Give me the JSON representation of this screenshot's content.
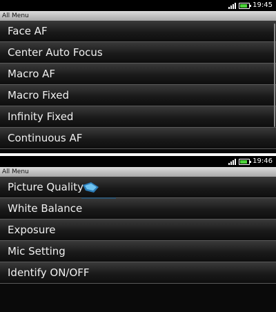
{
  "screen1": {
    "status": {
      "time": "19:45",
      "battery_level": 0.7
    },
    "title": "All Menu",
    "items": [
      {
        "label": "Face AF"
      },
      {
        "label": "Center Auto Focus"
      },
      {
        "label": "Macro AF"
      },
      {
        "label": "Macro Fixed"
      },
      {
        "label": "Infinity Fixed"
      },
      {
        "label": "Continuous AF"
      }
    ]
  },
  "screen2": {
    "status": {
      "time": "19:46",
      "battery_level": 0.7
    },
    "title": "All Menu",
    "items": [
      {
        "label": "Picture Quality"
      },
      {
        "label": "White Balance"
      },
      {
        "label": "Exposure"
      },
      {
        "label": "Mic Setting"
      },
      {
        "label": "Identify ON/OFF"
      }
    ]
  },
  "colors": {
    "battery": "#4cd23a",
    "titlebar": "#c4c4c4",
    "item_bg": "#1a1a1a",
    "divider": "#5a5a5a"
  },
  "icons": [
    "signal-icon",
    "battery-icon",
    "watermark-logo"
  ]
}
